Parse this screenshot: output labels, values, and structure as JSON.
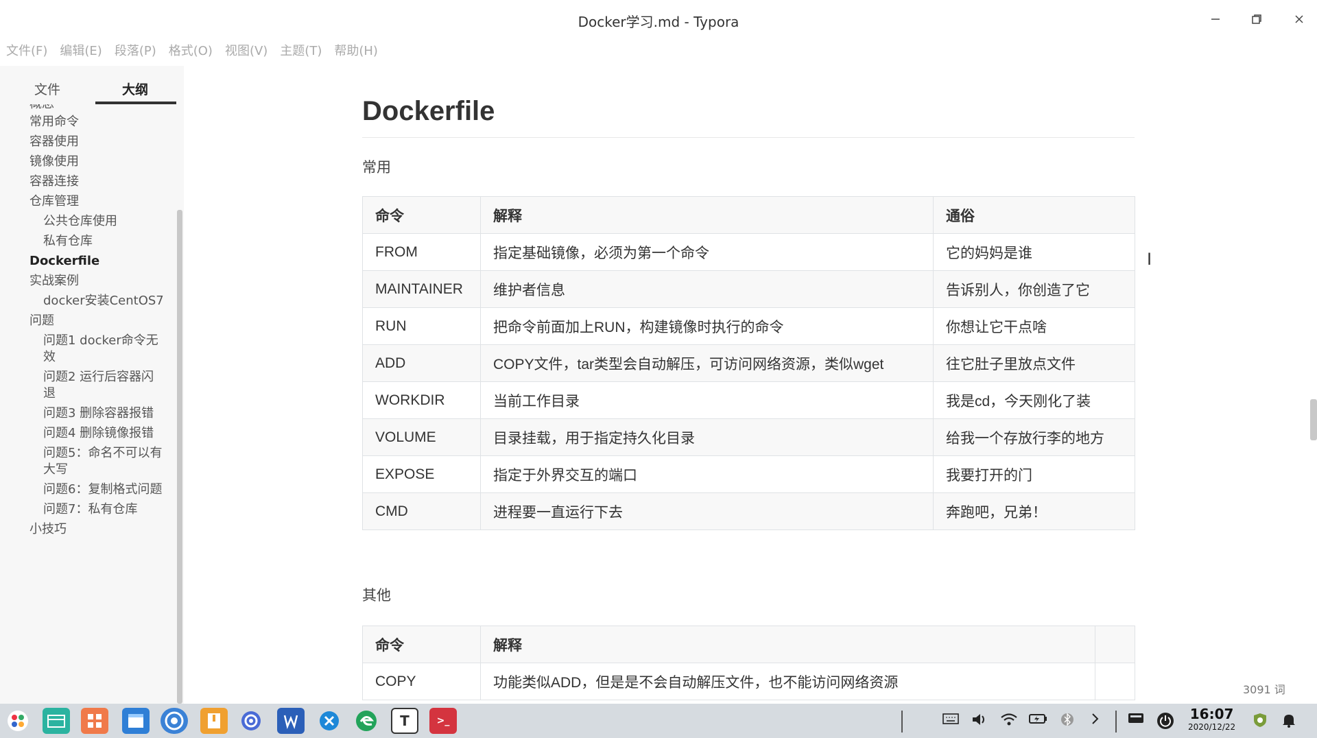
{
  "window": {
    "title": "Docker学习.md - Typora",
    "min_icon": "minimize-icon",
    "max_icon": "restore-icon",
    "close_icon": "close-icon"
  },
  "menu": [
    "文件(F)",
    "编辑(E)",
    "段落(P)",
    "格式(O)",
    "视图(V)",
    "主题(T)",
    "帮助(H)"
  ],
  "sidebar": {
    "tabs": {
      "files": "文件",
      "outline": "大纲"
    },
    "partial_top": "概念",
    "items": [
      {
        "label": "常用命令",
        "level": 1
      },
      {
        "label": "容器使用",
        "level": 1
      },
      {
        "label": "镜像使用",
        "level": 1
      },
      {
        "label": "容器连接",
        "level": 1
      },
      {
        "label": "仓库管理",
        "level": 1
      },
      {
        "label": "公共仓库使用",
        "level": 2
      },
      {
        "label": "私有仓库",
        "level": 2
      },
      {
        "label": "Dockerfile",
        "level": 1,
        "active": true
      },
      {
        "label": "实战案例",
        "level": 1
      },
      {
        "label": "docker安装CentOS7",
        "level": 2
      },
      {
        "label": "问题",
        "level": 1
      },
      {
        "label": "问题1 docker命令无效",
        "level": 2
      },
      {
        "label": "问题2 运行后容器闪退",
        "level": 2
      },
      {
        "label": "问题3 删除容器报错",
        "level": 2
      },
      {
        "label": "问题4 删除镜像报错",
        "level": 2
      },
      {
        "label": "问题5：命名不可以有大写",
        "level": 2
      },
      {
        "label": "问题6：复制格式问题",
        "level": 2
      },
      {
        "label": "问题7：私有仓库",
        "level": 2
      },
      {
        "label": "小技巧",
        "level": 1
      }
    ],
    "footer": {
      "back_icon": "chevron-left-icon",
      "source_icon": "source-code-icon"
    }
  },
  "doc": {
    "heading": "Dockerfile",
    "section1": "常用",
    "table1": {
      "headers": [
        "命令",
        "解释",
        "通俗"
      ],
      "rows": [
        [
          "FROM",
          "指定基础镜像，必须为第一个命令",
          "它的妈妈是谁"
        ],
        [
          "MAINTAINER",
          "维护者信息",
          "告诉别人，你创造了它"
        ],
        [
          "RUN",
          "把命令前面加上RUN，构建镜像时执行的命令",
          "你想让它干点啥"
        ],
        [
          "ADD",
          "COPY文件，tar类型会自动解压，可访问网络资源，类似wget",
          "往它肚子里放点文件"
        ],
        [
          "WORKDIR",
          "当前工作目录",
          "我是cd，今天刚化了装"
        ],
        [
          "VOLUME",
          "目录挂载，用于指定持久化目录",
          "给我一个存放行李的地方"
        ],
        [
          "EXPOSE",
          "指定于外界交互的端口",
          "我要打开的门"
        ],
        [
          "CMD",
          "进程要一直运行下去",
          "奔跑吧，兄弟！"
        ]
      ]
    },
    "section2": "其他",
    "table2": {
      "headers": [
        "命令",
        "解释",
        ""
      ],
      "rows": [
        [
          "COPY",
          "功能类似ADD，但是是不会自动解压文件，也不能访问网络资源",
          ""
        ]
      ]
    },
    "word_count": "3091 词"
  },
  "taskbar": {
    "apps": [
      "launcher-icon",
      "file-manager-icon",
      "app-store-icon",
      "store-icon",
      "browser-icon",
      "archive-icon",
      "settings-icon",
      "word-icon",
      "xmind-icon",
      "edge-icon",
      "typora-icon",
      "terminal-icon"
    ],
    "typora_letter": "T",
    "terminal_glyph": ">_",
    "tray": [
      "keyboard-icon",
      "volume-icon",
      "wifi-icon",
      "battery-icon",
      "bluetooth-icon",
      "chevron-right-icon",
      "display-icon",
      "power-icon"
    ],
    "time": "16:07",
    "date": "2020/12/22",
    "extra": [
      "security-icon",
      "bell-icon"
    ]
  }
}
